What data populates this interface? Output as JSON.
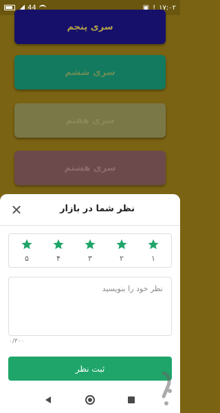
{
  "status_bar": {
    "time": "۱۷:۰۲",
    "signal_text": "44",
    "icons": [
      "battery-icon",
      "signal-icon",
      "wifi-icon",
      "gallery-icon",
      "alert-icon"
    ]
  },
  "background_list": {
    "items": [
      {
        "label": "سری پنجم"
      },
      {
        "label": "سری ششم"
      },
      {
        "label": "سری هفتم"
      },
      {
        "label": "سری هشتم"
      }
    ]
  },
  "rating_sheet": {
    "title": "نظر شما در بازار",
    "close_icon": "close-icon",
    "stars": [
      {
        "number": "۵"
      },
      {
        "number": "۴"
      },
      {
        "number": "۳"
      },
      {
        "number": "۲"
      },
      {
        "number": "۱"
      }
    ],
    "star_color": "#1fa56a",
    "comment": {
      "placeholder": "نظر خود را بنویسید",
      "value": ""
    },
    "char_count": "۰/۳۰۰",
    "submit_label": "ثبت نظر",
    "submit_color": "#1fa56a"
  },
  "nav_bar": {
    "icons": [
      "back-icon",
      "home-icon",
      "recents-icon"
    ]
  }
}
